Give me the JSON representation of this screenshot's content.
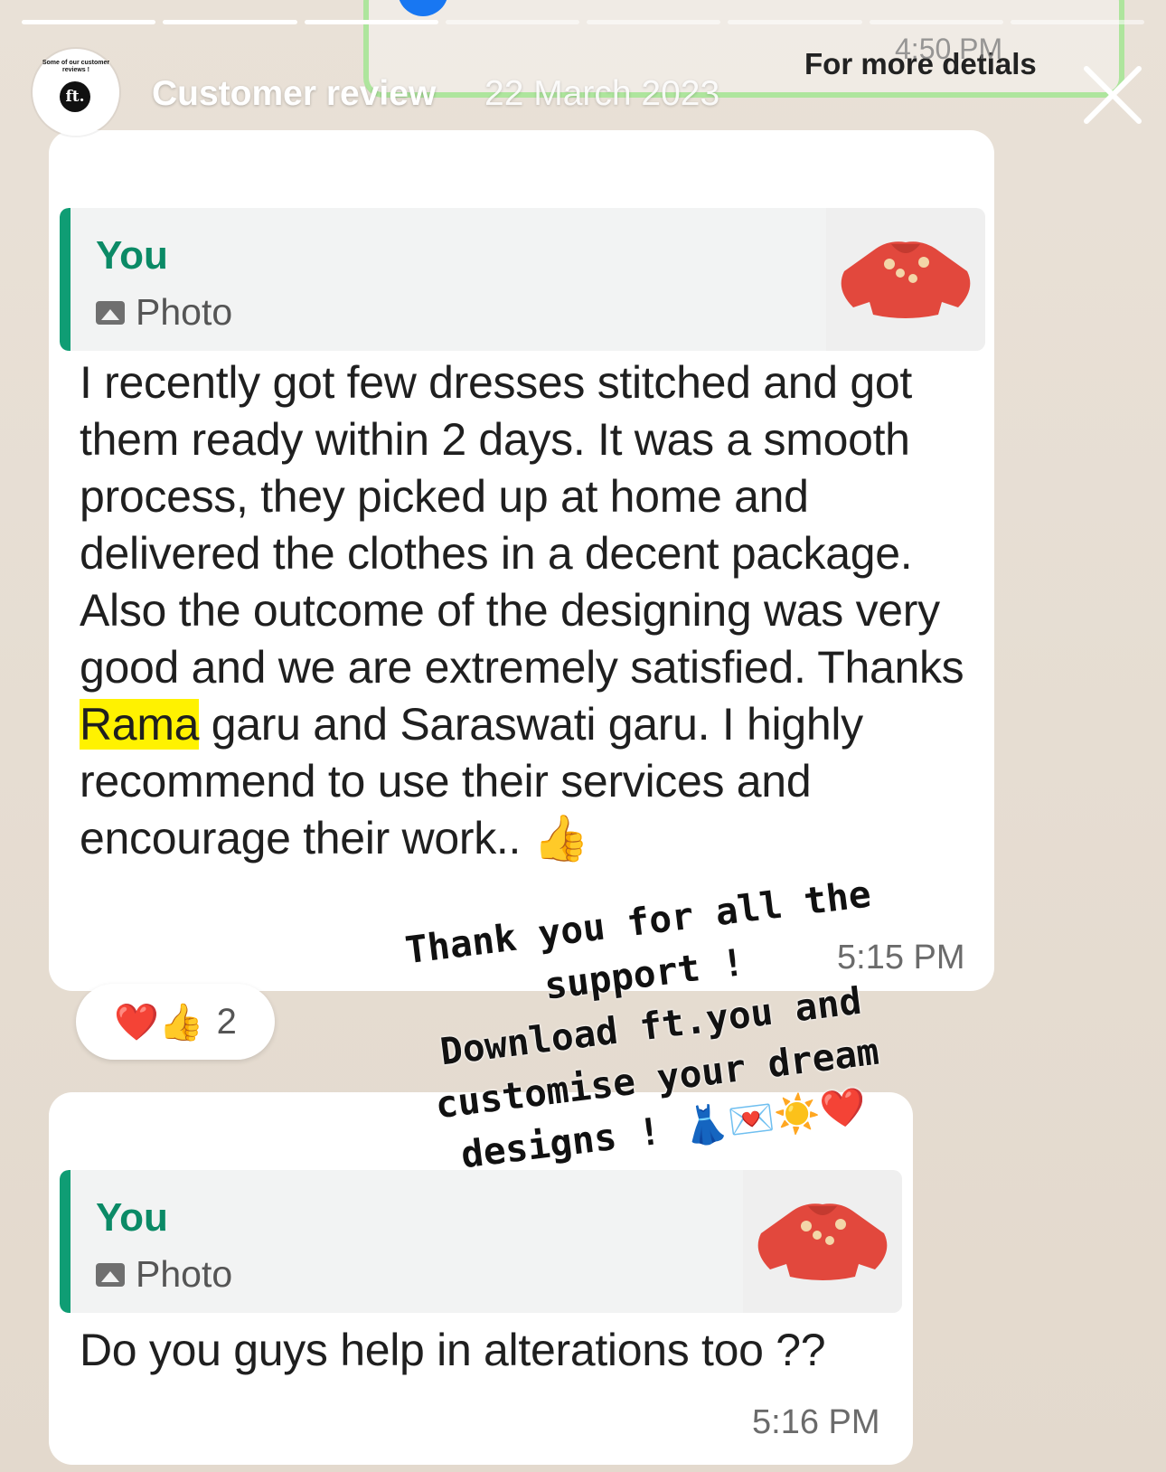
{
  "story": {
    "segments": 8,
    "active_segments": 3,
    "header": {
      "avatar_caption": "Some of our customer reviews !",
      "avatar_logo": "ft.",
      "title": "Customer review",
      "date": "22 March 2023"
    },
    "close_icon": "close-icon"
  },
  "top_message": {
    "text": "For more detials",
    "time": "4:50 PM",
    "icon": "facebook-icon",
    "accent": "#aee59d"
  },
  "message1": {
    "quote_author": "You",
    "quote_type": "Photo",
    "thumbnail": "red-blouse-image",
    "text_before": "I recently got few dresses stitched and got them ready within 2 days. It was a smooth process, they picked up at home and delivered the clothes in a decent package. Also the outcome of the designing was very good and we are extremely satisfied. Thanks ",
    "highlight": "Rama",
    "text_after": " garu and Saraswati garu.  I highly recommend to use their services and encourage their work.. 👍",
    "time": "5:15 PM",
    "reactions": {
      "emojis": "❤️👍",
      "count": "2"
    }
  },
  "message2": {
    "quote_author": "You",
    "quote_type": "Photo",
    "thumbnail": "red-blouse-image",
    "text": "Do you guys help in alterations too ??",
    "time": "5:16 PM"
  },
  "overlay": {
    "lines": [
      "Thank you for all the",
      "support !",
      "Download ft.you and",
      "customise your dream",
      "designs !  👗💌☀️❤️"
    ]
  },
  "colors": {
    "quote_bar": "#0f9d74",
    "author": "#0b8a66",
    "highlight": "#fff200"
  }
}
